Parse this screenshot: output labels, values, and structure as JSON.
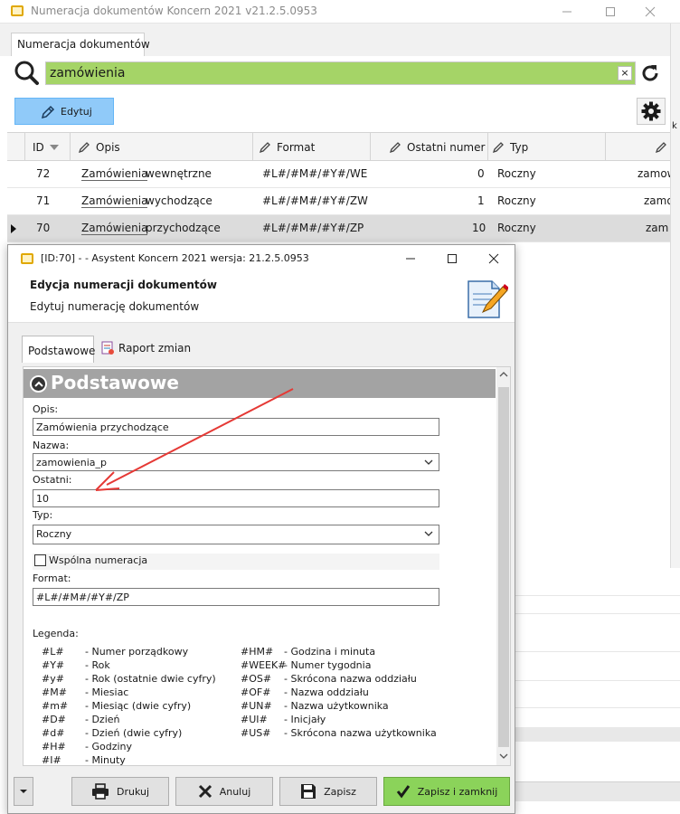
{
  "main_window": {
    "title": "Numeracja dokumentów Koncern 2021 v21.2.5.0953",
    "tab": "Numeracja dokumentów",
    "search_value": "zamówienia",
    "search_clear": "×",
    "edit_label": "Edytuj",
    "columns": [
      "ID",
      "Opis",
      "Format",
      "Ostatni numer",
      "Typ"
    ],
    "rows": [
      {
        "id": "72",
        "opis_hl": "Zamówienia",
        "opis_rest": " wewnętrzne",
        "format": "#L#/#M#/#Y#/WE",
        "last": "0",
        "typ": "Roczny",
        "extra": "zamow"
      },
      {
        "id": "71",
        "opis_hl": "Zamówienia",
        "opis_rest": " wychodzące",
        "format": "#L#/#M#/#Y#/ZW",
        "last": "1",
        "typ": "Roczny",
        "extra": "zamo"
      },
      {
        "id": "70",
        "opis_hl": "Zamówienia",
        "opis_rest": " przychodzące",
        "format": "#L#/#M#/#Y#/ZP",
        "last": "10",
        "typ": "Roczny",
        "extra": "zam"
      }
    ],
    "right_edge_text": "k o"
  },
  "dialog": {
    "title": "[ID:70] -  - Asystent Koncern 2021 wersja: 21.2.5.0953",
    "heading": "Edycja numeracji dokumentów",
    "subheading": "Edytuj numerację dokumentów",
    "tabs": [
      "Podstawowe",
      "Raport zmian"
    ],
    "section_title": "Podstawowe",
    "fields": {
      "opis_label": "Opis:",
      "opis_value": "Zamówienia przychodzące",
      "nazwa_label": "Nazwa:",
      "nazwa_value": "zamowienia_p",
      "ostatni_label": "Ostatni:",
      "ostatni_value": "10",
      "typ_label": "Typ:",
      "typ_value": "Roczny",
      "wspolna_label": "Wspólna numeracja",
      "format_label": "Format:",
      "format_value": "#L#/#M#/#Y#/ZP"
    },
    "legend_title": "Legenda:",
    "legend_left": [
      {
        "code": "#L#",
        "desc": "- Numer porządkowy"
      },
      {
        "code": "#Y#",
        "desc": "- Rok"
      },
      {
        "code": "#y#",
        "desc": "- Rok (ostatnie dwie cyfry)"
      },
      {
        "code": "#M#",
        "desc": "- Miesiac"
      },
      {
        "code": "#m#",
        "desc": "- Miesiąc (dwie cyfry)"
      },
      {
        "code": "#D#",
        "desc": "- Dzień"
      },
      {
        "code": "#d#",
        "desc": "- Dzień (dwie cyfry)"
      },
      {
        "code": "#H#",
        "desc": "- Godziny"
      },
      {
        "code": "#I#",
        "desc": "- Minuty"
      }
    ],
    "legend_right": [
      {
        "code": "#HM#",
        "desc": "- Godzina i minuta"
      },
      {
        "code": "#WEEK#",
        "desc": "- Numer tygodnia"
      },
      {
        "code": "#OS#",
        "desc": "- Skrócona nazwa oddziału"
      },
      {
        "code": "#OF#",
        "desc": "- Nazwa oddziału"
      },
      {
        "code": "#UN#",
        "desc": "- Nazwa użytkownika"
      },
      {
        "code": "#UI#",
        "desc": "- Inicjały"
      },
      {
        "code": "#US#",
        "desc": "- Skrócona nazwa użytkownika"
      }
    ],
    "buttons": {
      "print": "Drukuj",
      "cancel": "Anuluj",
      "save": "Zapisz",
      "save_close": "Zapisz i zamknij"
    }
  },
  "colors": {
    "search_bg": "#a5d467",
    "edit_btn_bg": "#90caf9",
    "save_close_bg": "#8bd35a",
    "section_header_bg": "#a3a3a3",
    "annotation_arrow": "#e53935"
  }
}
